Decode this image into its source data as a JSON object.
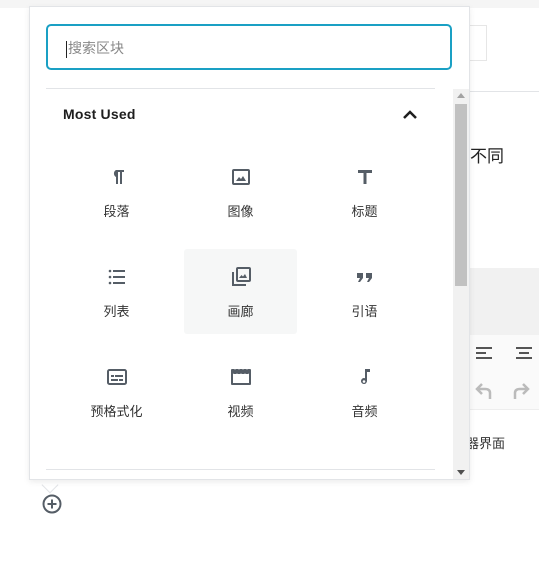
{
  "background": {
    "text_fragment_1": "不同",
    "text_fragment_2": "器界面"
  },
  "inserter": {
    "search": {
      "placeholder": "搜索区块",
      "value": ""
    },
    "section": {
      "title": "Most Used",
      "expanded": true
    },
    "blocks": [
      {
        "label": "段落",
        "icon": "paragraph-icon"
      },
      {
        "label": "图像",
        "icon": "image-icon"
      },
      {
        "label": "标题",
        "icon": "heading-icon"
      },
      {
        "label": "列表",
        "icon": "list-icon"
      },
      {
        "label": "画廊",
        "icon": "gallery-icon",
        "hovered": true
      },
      {
        "label": "引语",
        "icon": "quote-icon"
      },
      {
        "label": "预格式化",
        "icon": "preformatted-icon"
      },
      {
        "label": "视频",
        "icon": "video-icon"
      },
      {
        "label": "音频",
        "icon": "audio-icon"
      }
    ]
  },
  "colors": {
    "accent": "#1aa0c4",
    "icon": "#555d66"
  }
}
